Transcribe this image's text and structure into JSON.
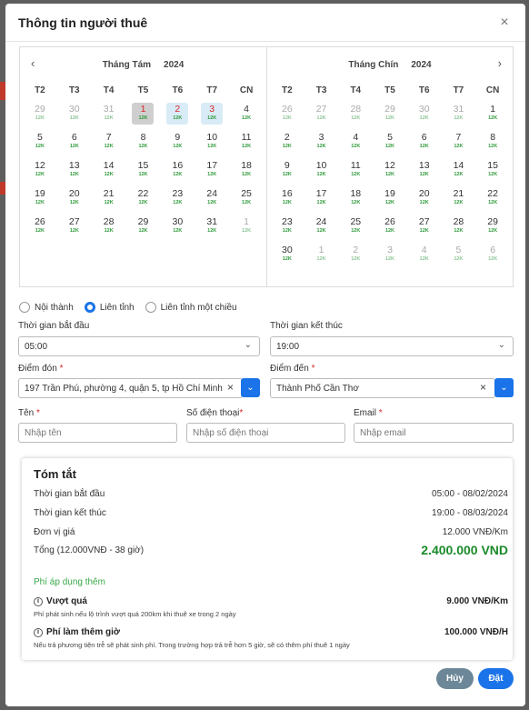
{
  "modal": {
    "title": "Thông tin người thuê",
    "close": "×"
  },
  "calendar": {
    "left": {
      "month": "Tháng Tám",
      "year": "2024",
      "prev": "‹",
      "weekdays": [
        "T2",
        "T3",
        "T4",
        "T5",
        "T6",
        "T7",
        "CN"
      ],
      "days": [
        {
          "n": "29",
          "p": "12K",
          "m": true
        },
        {
          "n": "30",
          "p": "12K",
          "m": true
        },
        {
          "n": "31",
          "p": "12K",
          "m": true
        },
        {
          "n": "1",
          "p": "12K",
          "s": "start",
          "r": true
        },
        {
          "n": "2",
          "p": "12K",
          "s": "range",
          "r": true
        },
        {
          "n": "3",
          "p": "12K",
          "s": "range",
          "r": true
        },
        {
          "n": "4",
          "p": "12K"
        },
        {
          "n": "5",
          "p": "12K"
        },
        {
          "n": "6",
          "p": "12K"
        },
        {
          "n": "7",
          "p": "12K"
        },
        {
          "n": "8",
          "p": "12K"
        },
        {
          "n": "9",
          "p": "12K"
        },
        {
          "n": "10",
          "p": "12K"
        },
        {
          "n": "11",
          "p": "12K"
        },
        {
          "n": "12",
          "p": "12K"
        },
        {
          "n": "13",
          "p": "12K"
        },
        {
          "n": "14",
          "p": "12K"
        },
        {
          "n": "15",
          "p": "12K"
        },
        {
          "n": "16",
          "p": "12K"
        },
        {
          "n": "17",
          "p": "12K"
        },
        {
          "n": "18",
          "p": "12K"
        },
        {
          "n": "19",
          "p": "12K"
        },
        {
          "n": "20",
          "p": "12K"
        },
        {
          "n": "21",
          "p": "12K"
        },
        {
          "n": "22",
          "p": "12K"
        },
        {
          "n": "23",
          "p": "12K"
        },
        {
          "n": "24",
          "p": "12K"
        },
        {
          "n": "25",
          "p": "12K"
        },
        {
          "n": "26",
          "p": "12K"
        },
        {
          "n": "27",
          "p": "12K"
        },
        {
          "n": "28",
          "p": "12K"
        },
        {
          "n": "29",
          "p": "12K"
        },
        {
          "n": "30",
          "p": "12K"
        },
        {
          "n": "31",
          "p": "12K"
        },
        {
          "n": "1",
          "p": "12K",
          "m": true
        }
      ]
    },
    "right": {
      "month": "Tháng Chín",
      "year": "2024",
      "next": "›",
      "weekdays": [
        "T2",
        "T3",
        "T4",
        "T5",
        "T6",
        "T7",
        "CN"
      ],
      "days": [
        {
          "n": "26",
          "p": "12K",
          "m": true
        },
        {
          "n": "27",
          "p": "12K",
          "m": true
        },
        {
          "n": "28",
          "p": "12K",
          "m": true
        },
        {
          "n": "29",
          "p": "12K",
          "m": true
        },
        {
          "n": "30",
          "p": "12K",
          "m": true
        },
        {
          "n": "31",
          "p": "12K",
          "m": true
        },
        {
          "n": "1",
          "p": "12K"
        },
        {
          "n": "2",
          "p": "12K"
        },
        {
          "n": "3",
          "p": "12K"
        },
        {
          "n": "4",
          "p": "12K"
        },
        {
          "n": "5",
          "p": "12K"
        },
        {
          "n": "6",
          "p": "12K"
        },
        {
          "n": "7",
          "p": "12K"
        },
        {
          "n": "8",
          "p": "12K"
        },
        {
          "n": "9",
          "p": "12K"
        },
        {
          "n": "10",
          "p": "12K"
        },
        {
          "n": "11",
          "p": "12K"
        },
        {
          "n": "12",
          "p": "12K"
        },
        {
          "n": "13",
          "p": "12K"
        },
        {
          "n": "14",
          "p": "12K"
        },
        {
          "n": "15",
          "p": "12K"
        },
        {
          "n": "16",
          "p": "12K"
        },
        {
          "n": "17",
          "p": "12K"
        },
        {
          "n": "18",
          "p": "12K"
        },
        {
          "n": "19",
          "p": "12K"
        },
        {
          "n": "20",
          "p": "12K"
        },
        {
          "n": "21",
          "p": "12K"
        },
        {
          "n": "22",
          "p": "12K"
        },
        {
          "n": "23",
          "p": "12K"
        },
        {
          "n": "24",
          "p": "12K"
        },
        {
          "n": "25",
          "p": "12K"
        },
        {
          "n": "26",
          "p": "12K"
        },
        {
          "n": "27",
          "p": "12K"
        },
        {
          "n": "28",
          "p": "12K"
        },
        {
          "n": "29",
          "p": "12K"
        },
        {
          "n": "30",
          "p": "12K"
        },
        {
          "n": "1",
          "p": "12K",
          "m": true
        },
        {
          "n": "2",
          "p": "12K",
          "m": true
        },
        {
          "n": "3",
          "p": "12K",
          "m": true
        },
        {
          "n": "4",
          "p": "12K",
          "m": true
        },
        {
          "n": "5",
          "p": "12K",
          "m": true
        },
        {
          "n": "6",
          "p": "12K",
          "m": true
        }
      ]
    }
  },
  "trip_type": {
    "options": [
      "Nội thành",
      "Liên tỉnh",
      "Liên tỉnh một chiều"
    ],
    "selected": "Liên tỉnh"
  },
  "form": {
    "start_time_label": "Thời gian bắt đầu",
    "start_time": "05:00",
    "end_time_label": "Thời gian kết thúc",
    "end_time": "19:00",
    "pickup_label": "Điểm đón",
    "pickup": "197 Trần Phú, phường 4, quận 5, tp Hồ Chí Minh",
    "dropoff_label": "Điểm đến",
    "dropoff": "Thành Phố Cần Thơ",
    "required_mark": "*",
    "name_label": "Tên",
    "name_placeholder": "Nhập tên",
    "phone_label": "Số điện thoại",
    "phone_placeholder": "Nhập số điện thoại",
    "email_label": "Email",
    "email_placeholder": "Nhập email",
    "clear": "×",
    "dropdown": "⌄"
  },
  "summary": {
    "title": "Tóm tắt",
    "start_label": "Thời gian bắt đầu",
    "start_value": "05:00 - 08/02/2024",
    "end_label": "Thời gian kết thúc",
    "end_value": "19:00 - 08/03/2024",
    "unit_label": "Đơn vị giá",
    "unit_value": "12.000 VNĐ/Km",
    "total_label": "Tổng (12.000VNĐ - 38 giờ)",
    "total_value": "2.400.000 VND",
    "extra_title": "Phí áp dụng thêm",
    "fees": [
      {
        "name": "Vượt quá",
        "value": "9.000 VNĐ/Km",
        "desc": "Phí phát sinh nếu lộ trình vượt quá 200km khi thuê xe trong 2 ngày"
      },
      {
        "name": "Phí làm thêm giờ",
        "value": "100.000 VNĐ/H",
        "desc": "Nếu trả phương tiện trễ sẽ phát sinh phí. Trong trường hợp trả trễ hơn 5 giờ, sẽ có thêm phí thuê 1 ngày"
      }
    ],
    "info_icon": "i"
  },
  "buttons": {
    "cancel": "Hủy",
    "book": "Đặt"
  },
  "colors": {
    "accent": "#1a73e8",
    "total": "#1a8a2a",
    "price": "#2e9a3a",
    "required": "#d7262b"
  }
}
